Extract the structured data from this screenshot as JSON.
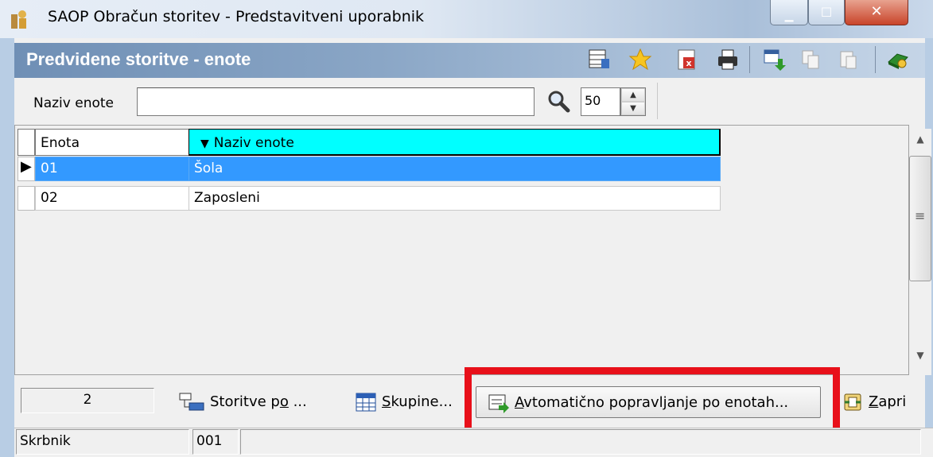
{
  "window": {
    "title": "SAOP Obračun storitev - Predstavitveni uporabnik"
  },
  "panel": {
    "title": "Predvidene storitve - enote"
  },
  "filter": {
    "label": "Naziv enote",
    "value": "",
    "count": "50"
  },
  "table": {
    "columns": [
      "Enota",
      "Naziv enote"
    ],
    "rows": [
      {
        "enota": "01",
        "naziv": "Šola",
        "selected": true
      },
      {
        "enota": "02",
        "naziv": "Zaposleni",
        "selected": false
      }
    ]
  },
  "footer": {
    "record_count": "2",
    "buttons": {
      "storitve": {
        "pre": "Storitve p",
        "acc": "o",
        "post": " ..."
      },
      "skupine": {
        "pre": "",
        "acc": "S",
        "post": "kupine..."
      },
      "avto": {
        "pre": "",
        "acc": "A",
        "post": "vtomatično popravljanje po enotah..."
      },
      "zapri": {
        "pre": "",
        "acc": "Z",
        "post": "apri"
      }
    }
  },
  "status": {
    "user": "Skrbnik",
    "code": "001"
  },
  "colors": {
    "header_cell_active": "#00ffff",
    "selection": "#3399ff",
    "highlight": "#e8101a"
  },
  "icons": [
    "app-icon",
    "grid-settings-icon",
    "favorite-star-icon",
    "export-excel-icon",
    "print-icon",
    "calendar-download-icon",
    "copy-icon",
    "paste-icon",
    "exit-book-icon",
    "search-icon"
  ]
}
